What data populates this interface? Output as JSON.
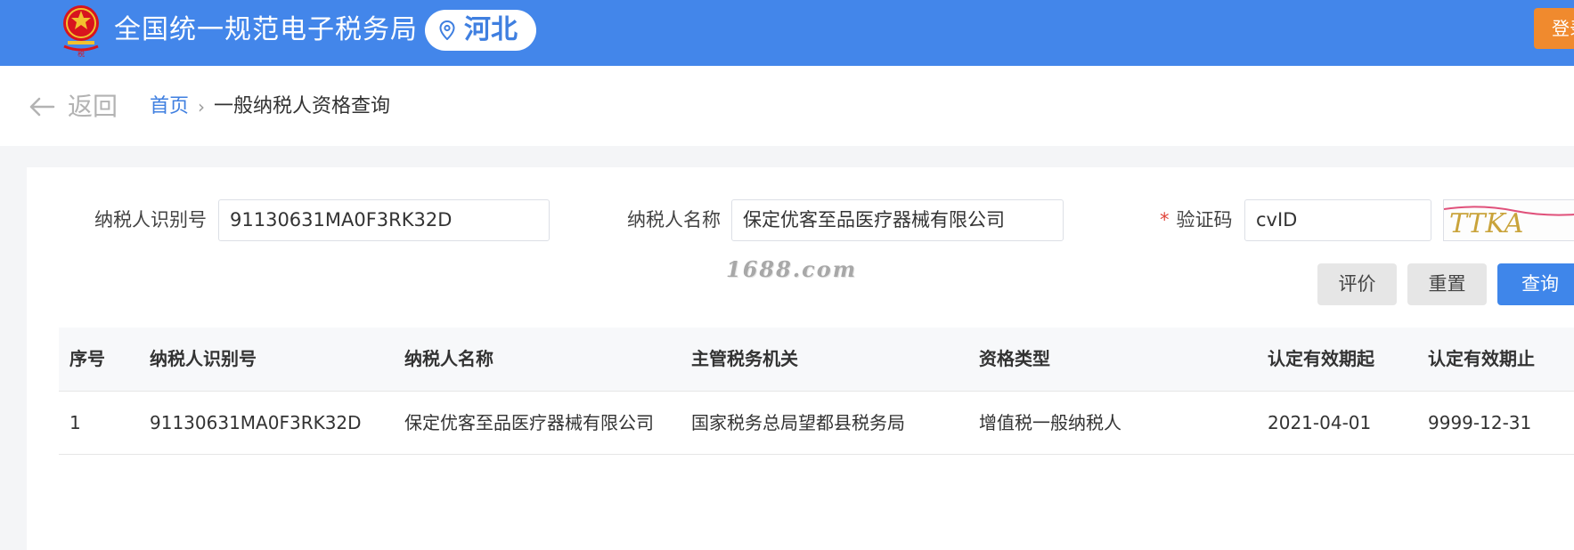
{
  "header": {
    "site_title": "全国统一规范电子税务局",
    "region": "河北",
    "login_label": "登录",
    "emblem_text": "税",
    "bg_color": "#4386ea",
    "login_color": "#f08a2e"
  },
  "nav": {
    "back_label": "返回",
    "breadcrumb": {
      "home": "首页",
      "separator": "›",
      "current": "一般纳税人资格查询"
    }
  },
  "form": {
    "taxpayer_id_label": "纳税人识别号",
    "taxpayer_id_value": "91130631MA0F3RK32D",
    "taxpayer_name_label": "纳税人名称",
    "taxpayer_name_value": "保定优客至品医疗器械有限公司",
    "captcha_required_mark": "*",
    "captcha_label": "验证码",
    "captcha_value": "cvID",
    "captcha_image_text": "TTKA",
    "watermark": "1688.com"
  },
  "actions": {
    "evaluate": "评价",
    "reset": "重置",
    "query": "查询",
    "primary_color": "#3f86ea"
  },
  "table": {
    "columns": [
      "序号",
      "纳税人识别号",
      "纳税人名称",
      "主管税务机关",
      "资格类型",
      "认定有效期起",
      "认定有效期止"
    ],
    "rows": [
      [
        "1",
        "91130631MA0F3RK32D",
        "保定优客至品医疗器械有限公司",
        "国家税务总局望都县税务局",
        "增值税一般纳税人",
        "2021-04-01",
        "9999-12-31"
      ]
    ]
  }
}
